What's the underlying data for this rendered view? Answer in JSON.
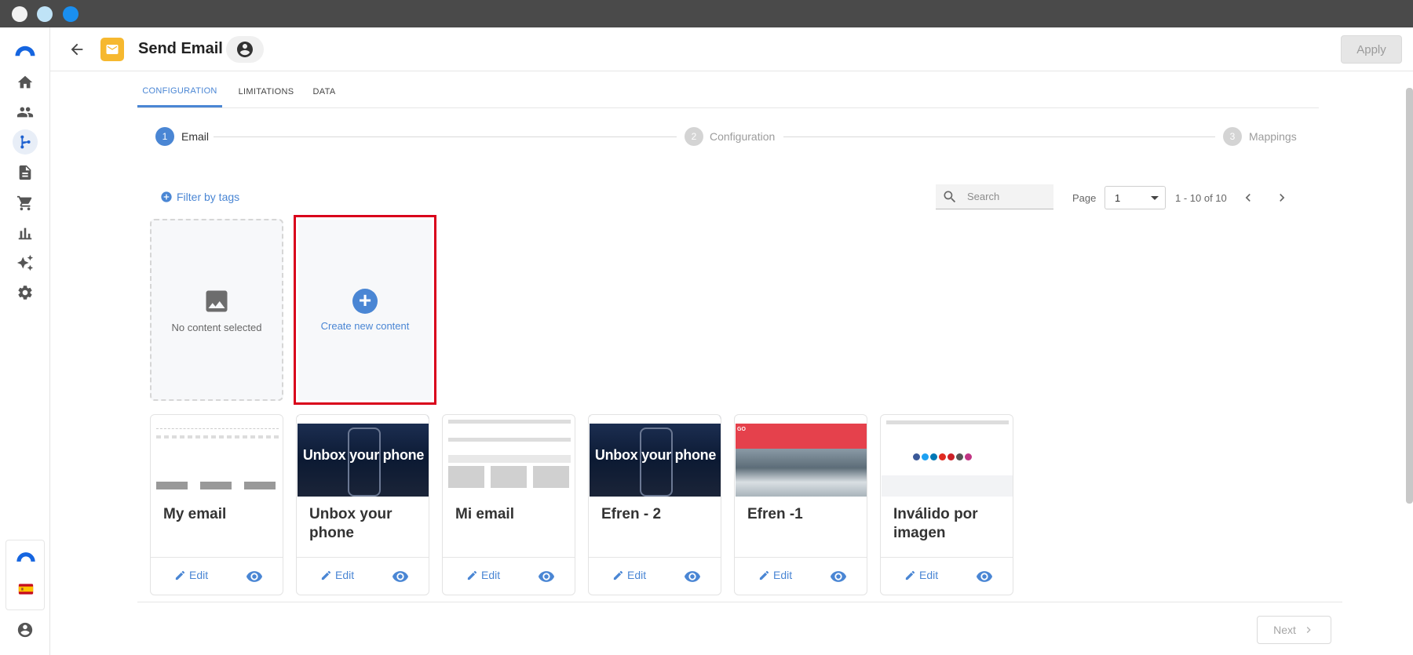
{
  "header": {
    "title": "Send Email",
    "apply_label": "Apply"
  },
  "tabs": [
    "CONFIGURATION",
    "LIMITATIONS",
    "DATA"
  ],
  "steps": [
    {
      "number": "1",
      "label": "Email"
    },
    {
      "number": "2",
      "label": "Configuration"
    },
    {
      "number": "3",
      "label": "Mappings"
    }
  ],
  "toolbar": {
    "filter_label": "Filter by tags",
    "search_placeholder": "Search",
    "page_label": "Page",
    "page_value": "1",
    "range": "1 - 10 of 10"
  },
  "empty_card": {
    "label": "No content selected"
  },
  "create_card": {
    "label": "Create new content"
  },
  "cards": [
    {
      "title": "My email",
      "edit_label": "Edit"
    },
    {
      "title": "Unbox your phone",
      "edit_label": "Edit",
      "thumb_text": "Unbox your phone"
    },
    {
      "title": "Mi email",
      "edit_label": "Edit"
    },
    {
      "title": "Efren - 2",
      "edit_label": "Edit",
      "thumb_text": "Unbox your phone"
    },
    {
      "title": "Efren -1",
      "edit_label": "Edit"
    },
    {
      "title": "Inválido por imagen",
      "edit_label": "Edit"
    }
  ],
  "footer": {
    "next_label": "Next"
  },
  "colors": {
    "accent": "#4a86d4",
    "highlight": "#d9001b",
    "mail_badge": "#f6b82f"
  }
}
